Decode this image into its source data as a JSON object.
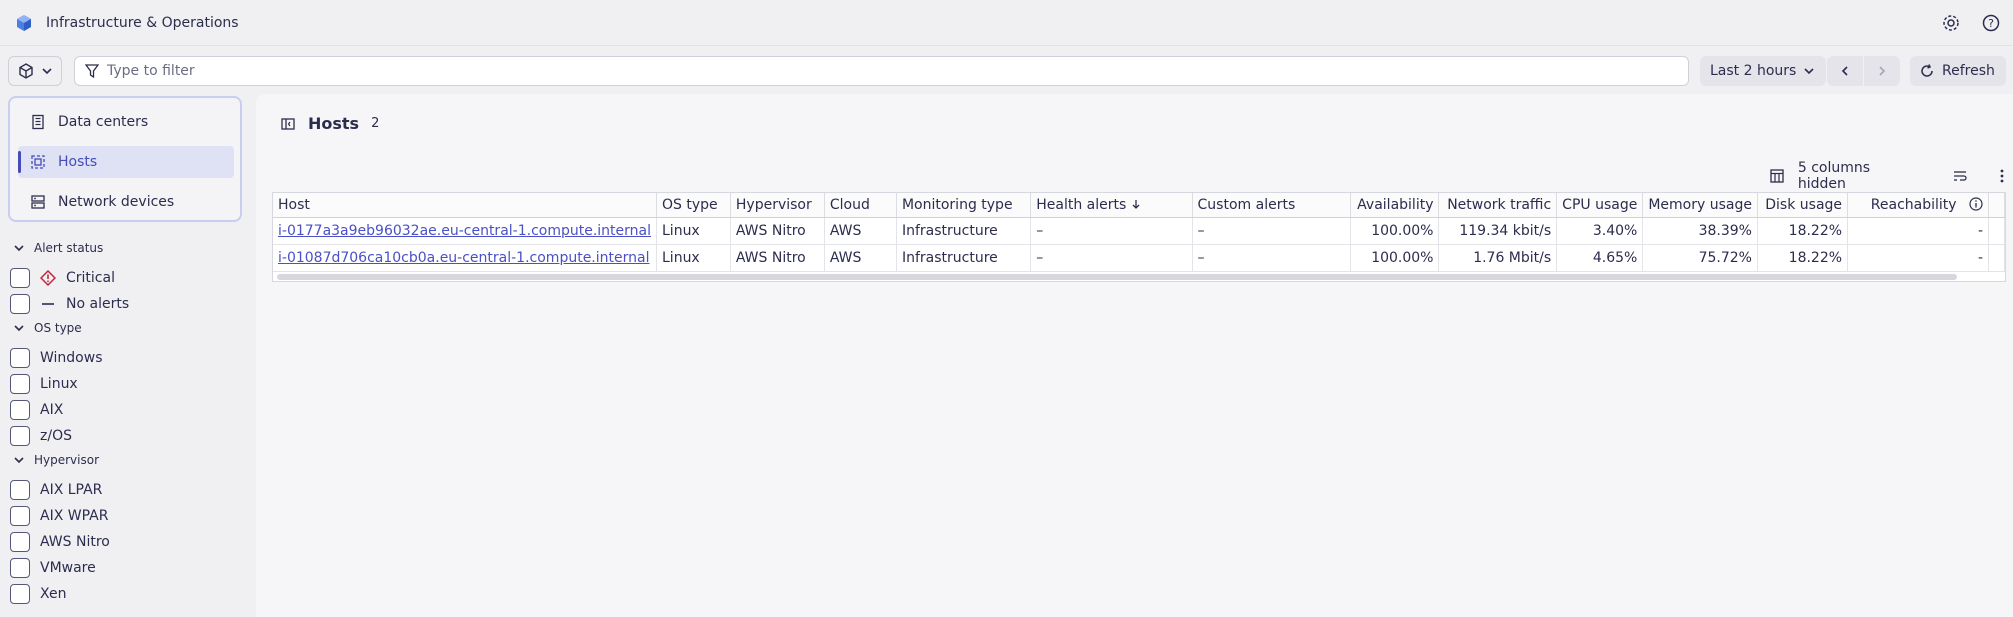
{
  "app": {
    "title": "Infrastructure & Operations",
    "logo": "cube-logo"
  },
  "topbar": {
    "settings_icon": "gear-icon",
    "help_icon": "help-icon"
  },
  "filterbar": {
    "segment_icon": "cube-icon",
    "filter_placeholder": "Type to filter",
    "timeframe_label": "Last 2 hours",
    "refresh_label": "Refresh"
  },
  "sidebar": {
    "nav": [
      {
        "label": "Data centers",
        "icon": "building-icon"
      },
      {
        "label": "Hosts",
        "icon": "host-icon",
        "active": true
      },
      {
        "label": "Network devices",
        "icon": "network-icon"
      }
    ],
    "sections": [
      {
        "title": "Alert status",
        "options": [
          "Critical",
          "No alerts"
        ]
      },
      {
        "title": "OS type",
        "options": [
          "Windows",
          "Linux",
          "AIX",
          "z/OS"
        ]
      },
      {
        "title": "Hypervisor",
        "options": [
          "AIX LPAR",
          "AIX WPAR",
          "AWS Nitro",
          "VMware",
          "Xen"
        ]
      }
    ]
  },
  "main": {
    "title": "Hosts",
    "count": "2",
    "columns_hidden_label": "5 columns hidden"
  },
  "table": {
    "headers": [
      "Host",
      "OS type",
      "Hypervisor",
      "Cloud",
      "Monitoring type",
      "Health alerts",
      "Custom alerts",
      "Availability",
      "Network traffic",
      "CPU usage",
      "Memory usage",
      "Disk usage",
      "Reachability"
    ],
    "rows": [
      [
        "i-0177a3a9eb96032ae.eu-central-1.compute.internal",
        "Linux",
        "AWS Nitro",
        "AWS",
        "Infrastructure",
        "–",
        "–",
        "100.00%",
        "119.34 kbit/s",
        "3.40%",
        "38.39%",
        "18.22%",
        "-"
      ],
      [
        "i-01087d706ca10cb0a.eu-central-1.compute.internal",
        "Linux",
        "AWS Nitro",
        "AWS",
        "Infrastructure",
        "–",
        "–",
        "100.00%",
        "1.76 Mbit/s",
        "4.65%",
        "75.72%",
        "18.22%",
        "-"
      ]
    ]
  },
  "colors": {
    "accent": "#454cb8",
    "link": "#4a50c6",
    "critical": "#c4233e"
  }
}
